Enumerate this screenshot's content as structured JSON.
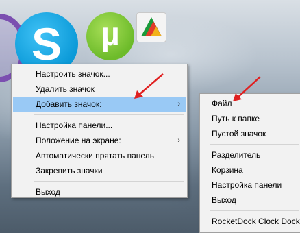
{
  "dock": {
    "icons": [
      "purple-app-icon",
      "skype-icon",
      "utorrent-icon",
      "faststone-icon"
    ],
    "skype_letter": "S",
    "utorrent_letter": "µ"
  },
  "context_menu": {
    "items": [
      {
        "label": "Настроить значок..."
      },
      {
        "label": "Удалить значок"
      },
      {
        "label": "Добавить значок:",
        "has_submenu": true,
        "highlighted": true
      },
      {
        "label": "Настройка панели..."
      },
      {
        "label": "Положение на экране:",
        "has_submenu": true
      },
      {
        "label": "Автоматически прятать панель"
      },
      {
        "label": "Закрепить значки"
      },
      {
        "label": "Выход"
      }
    ],
    "submenu_arrow": "›"
  },
  "submenu": {
    "items": [
      {
        "label": "Файл"
      },
      {
        "label": "Путь к папке"
      },
      {
        "label": "Пустой значок"
      },
      {
        "label": "Разделитель"
      },
      {
        "label": "Корзина"
      },
      {
        "label": "Настройка панели"
      },
      {
        "label": "Выход"
      },
      {
        "label": "RocketDock Clock Docklet"
      }
    ]
  },
  "colors": {
    "highlight": "#99c9f5",
    "annotation_arrow": "#e02020"
  }
}
